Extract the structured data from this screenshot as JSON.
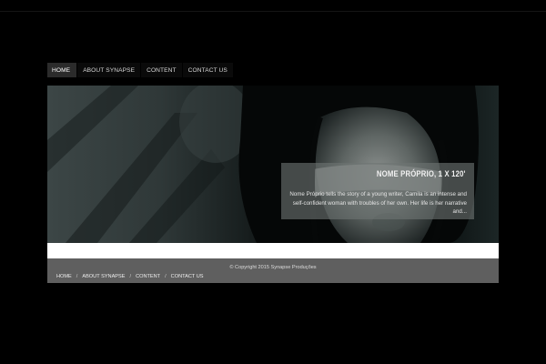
{
  "nav": {
    "items": [
      {
        "label": "HOME",
        "active": true
      },
      {
        "label": "ABOUT SYNAPSE",
        "active": false
      },
      {
        "label": "CONTENT",
        "active": false
      },
      {
        "label": "CONTACT US",
        "active": false
      }
    ]
  },
  "hero": {
    "title": "Nome Próprio, 1 x 120'",
    "description": "Nome Próprio tells the story of a young writer, Camila is an intense and self-confident woman with troubles of her own. Her life is her narrative and..."
  },
  "footer": {
    "copyright": "© Copyright 2015 Synapse Produções",
    "links": [
      "HOME",
      "ABOUT SYNAPSE",
      "CONTENT",
      "CONTACT US"
    ],
    "separator": "/"
  },
  "colors": {
    "background": "#000000",
    "nav_active": "#2b2b2b",
    "caption_overlay": "#6e7472",
    "footer": "#5f5f5f",
    "band": "#ffffff"
  }
}
